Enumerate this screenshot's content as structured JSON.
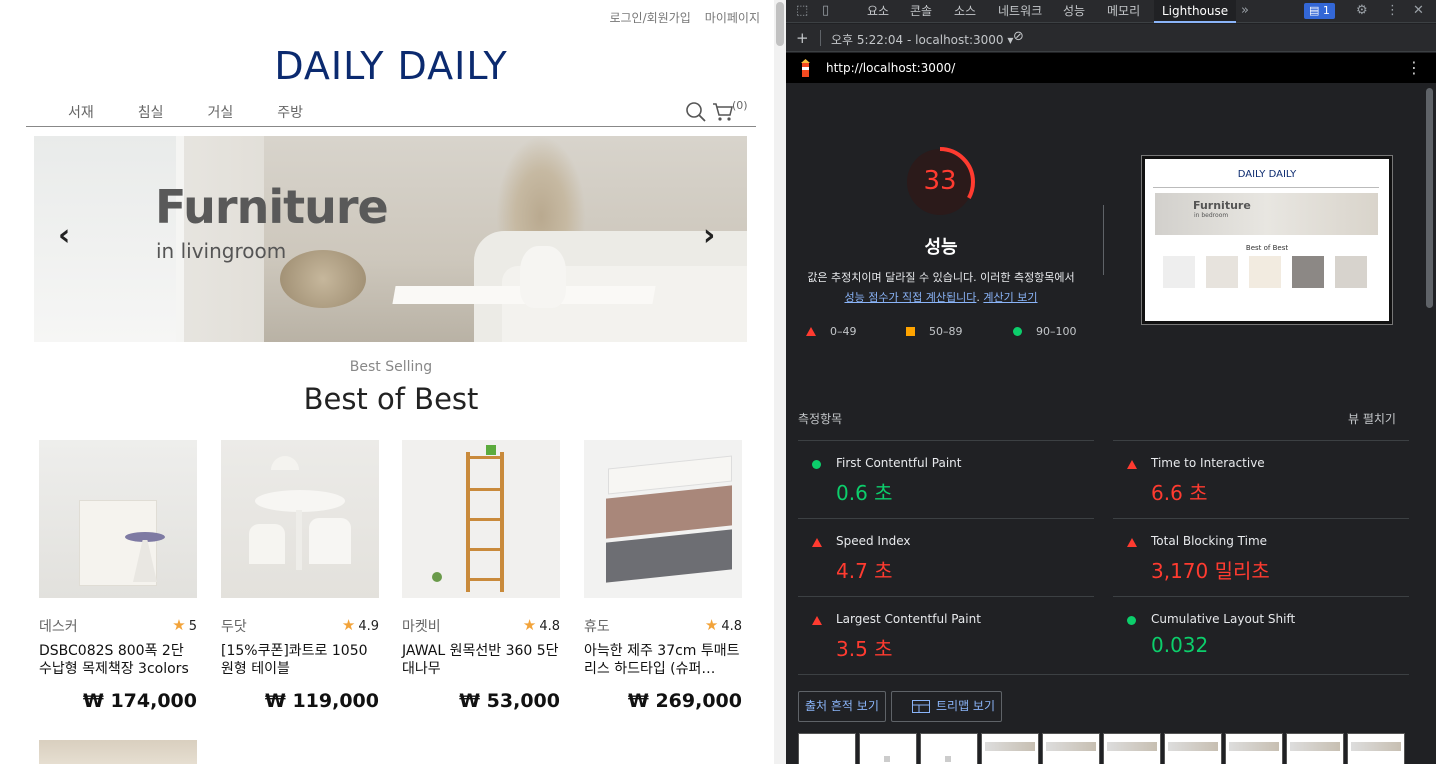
{
  "shop": {
    "top_links": {
      "login": "로그인/회원가입",
      "mypage": "마이페이지"
    },
    "logo": "DAILY DAILY",
    "nav": {
      "items": [
        "서재",
        "침실",
        "거실",
        "주방"
      ],
      "cart_count": "(0)"
    },
    "banner": {
      "title": "Furniture",
      "subtitle": "in livingroom",
      "prev": "‹",
      "next": "›"
    },
    "section": {
      "sub": "Best Selling",
      "title": "Best of Best"
    },
    "products": [
      {
        "brand": "데스커",
        "rating": "5",
        "name": "DSBC082S 800폭 2단 수납형 목제책장 3colors",
        "price": "₩ 174,000"
      },
      {
        "brand": "두닷",
        "rating": "4.9",
        "name": "[15%쿠폰]콰트로 1050 원형 테이블",
        "price": "₩ 119,000"
      },
      {
        "brand": "마켓비",
        "rating": "4.8",
        "name": "JAWAL 원목선반 360 5단 대나무",
        "price": "₩ 53,000"
      },
      {
        "brand": "휴도",
        "rating": "4.8",
        "name": "아늑한 제주 37cm 투매트리스 하드타입 (슈퍼…",
        "price": "₩ 269,000"
      }
    ]
  },
  "devtools": {
    "tabs": [
      "요소",
      "콘솔",
      "소스",
      "네트워크",
      "성능",
      "메모리",
      "Lighthouse"
    ],
    "active_tab": "Lighthouse",
    "issues_count": "1",
    "report_label": "오후 5:22:04 - localhost:3000",
    "url": "http://localhost:3000/",
    "score": {
      "value": 33,
      "fraction": 0.33,
      "color": "#ff3b30"
    },
    "category_title": "성능",
    "description": "값은 추정치이며 달라질 수 있습니다. 이러한 측정항목에서",
    "description_link1": "성능 점수가 직접 계산됩니다",
    "description_link2": "계산기 보기",
    "legend": {
      "fail": "0–49",
      "average": "50–89",
      "pass": "90–100"
    },
    "metrics_header": "측정항목",
    "metrics_expand": "뷰 펼치기",
    "metrics": [
      {
        "label": "First Contentful Paint",
        "value": "0.6 초",
        "status": "pass"
      },
      {
        "label": "Time to Interactive",
        "value": "6.6 초",
        "status": "fail"
      },
      {
        "label": "Speed Index",
        "value": "4.7 초",
        "status": "fail"
      },
      {
        "label": "Total Blocking Time",
        "value": "3,170 밀리초",
        "status": "fail"
      },
      {
        "label": "Largest Contentful Paint",
        "value": "3.5 초",
        "status": "fail"
      },
      {
        "label": "Cumulative Layout Shift",
        "value": "0.032",
        "status": "pass"
      }
    ],
    "buttons": {
      "trace": "출처 흔적 보기",
      "treemap": "트리맵 보기"
    },
    "screenshot": {
      "logo": "DAILY DAILY",
      "title": "Furniture",
      "subtitle": "in bedroom",
      "section": "Best of Best"
    }
  },
  "colors": {
    "logo": "#0b2a6f",
    "fail": "#ff3b30",
    "average": "#ffa400",
    "pass": "#0cce6b",
    "link": "#8ab4f8"
  }
}
